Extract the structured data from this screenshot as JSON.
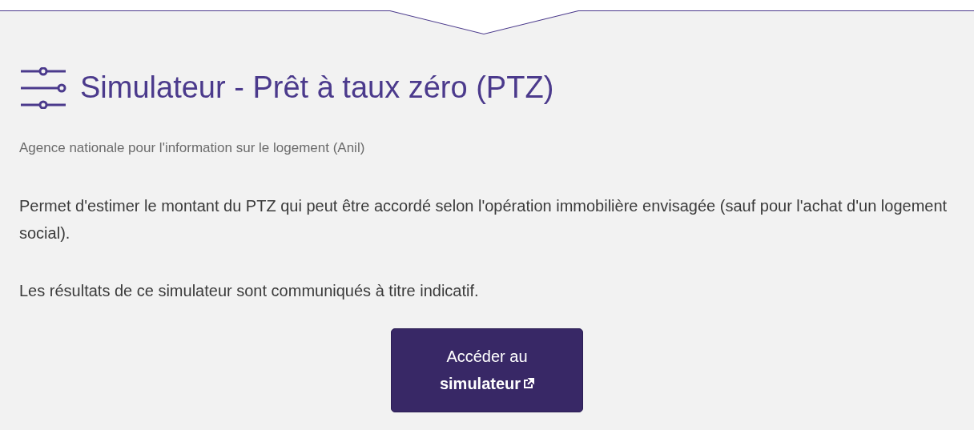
{
  "title": "Simulateur - Prêt à taux zéro (PTZ)",
  "source": "Agence nationale pour l'information sur le logement (Anil)",
  "paragraphs": [
    "Permet d'estimer le montant du PTZ qui peut être accordé selon l'opération immobilière envisagée (sauf pour l'achat d'un logement social).",
    "Les résultats de ce simulateur sont communiqués à titre indicatif."
  ],
  "button": {
    "label": "Accéder au **simulateur**",
    "external": true
  }
}
